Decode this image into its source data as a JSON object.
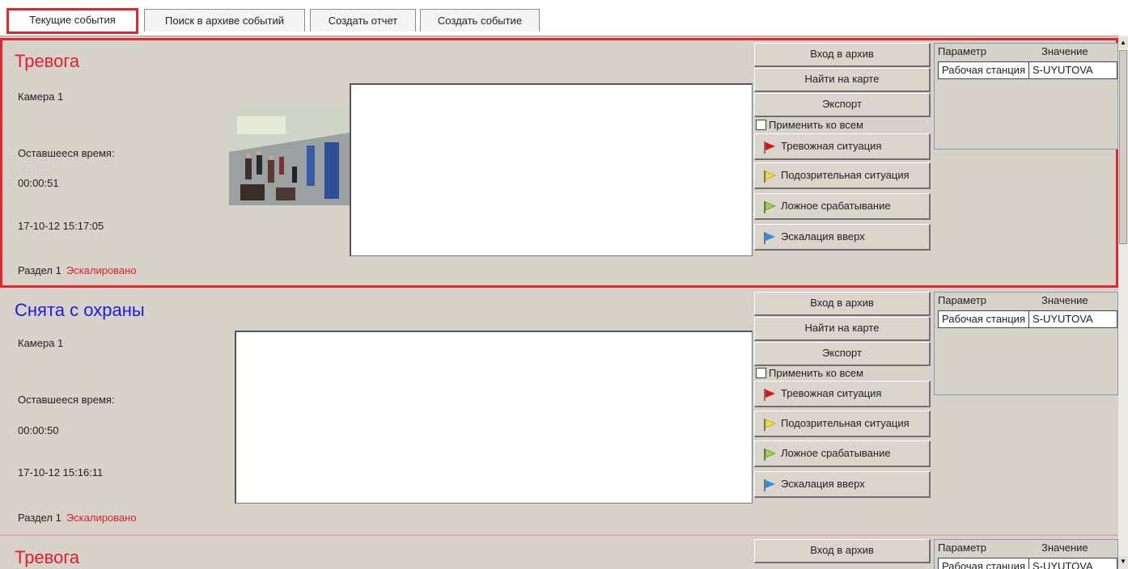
{
  "tabs": [
    {
      "label": "Текущие события",
      "active": true
    },
    {
      "label": "Поиск в архиве событий",
      "active": false
    },
    {
      "label": "Создать отчет",
      "active": false
    },
    {
      "label": "Создать событие",
      "active": false
    }
  ],
  "common": {
    "btn_archive": "Вход в архив",
    "btn_map": "Найти на карте",
    "btn_export": "Экспорт",
    "apply_all": "Применить ко всем",
    "flag_alarm": "Тревожная ситуация",
    "flag_suspicious": "Подозрительная ситуация",
    "flag_false": "Ложное срабатывание",
    "flag_escalate": "Эскалация вверх",
    "param_header": "Параметр",
    "value_header": "Значение",
    "remaining_label": "Оставшееся время:"
  },
  "events": [
    {
      "title": "Тревога",
      "camera": "Камера 1",
      "remaining": "00:00:51",
      "datetime": "17-10-12 15:17:05",
      "section": "Раздел 1",
      "status": "Эскалировано",
      "param_name": "Рабочая станция",
      "param_value": "S-UYUTOVA"
    },
    {
      "title": "Снята с охраны",
      "camera": "Камера 1",
      "remaining": "00:00:50",
      "datetime": "17-10-12 15:16:11",
      "section": "Раздел 1",
      "status": "Эскалировано",
      "param_name": "Рабочая станция",
      "param_value": "S-UYUTOVA"
    },
    {
      "title": "Тревога",
      "param_name": "Рабочая станция",
      "param_value": "S-UYUTOVA"
    }
  ],
  "colors": {
    "alarm": "#e0202a",
    "disarmed": "#1d1de0",
    "flag_red": "#e01010",
    "flag_yellow": "#f2dd3a",
    "flag_green": "#9ad64a",
    "flag_blue": "#2a8fe0",
    "selection": "#e3262b"
  },
  "icons": [
    "flag-red-icon",
    "flag-yellow-icon",
    "flag-green-icon",
    "flag-blue-icon",
    "scroll-up-icon",
    "scroll-down-icon"
  ]
}
